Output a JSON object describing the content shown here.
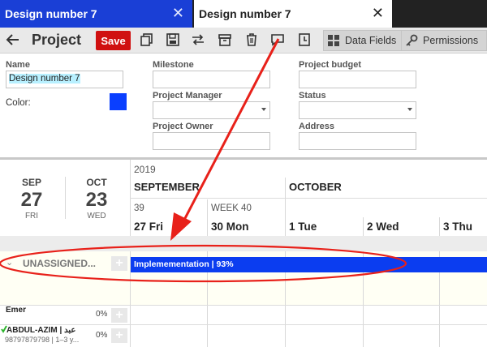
{
  "tabs": [
    {
      "title": "Design number 7",
      "active": false
    },
    {
      "title": "Design number 7",
      "active": true
    }
  ],
  "toolbar": {
    "title": "Project",
    "save_label": "Save",
    "data_fields_label": "Data Fields",
    "permissions_label": "Permissions",
    "icons": [
      "back-arrow-icon",
      "copy-icon",
      "save-all-icon",
      "swap-icon",
      "archive-icon",
      "delete-icon",
      "comment-icon",
      "history-icon"
    ]
  },
  "form": {
    "name_label": "Name",
    "name_value": "Design number 7",
    "color_label": "Color:",
    "color_value": "#0a3fff",
    "milestone_label": "Milestone",
    "milestone_value": "",
    "project_manager_label": "Project Manager",
    "project_manager_value": "",
    "project_owner_label": "Project Owner",
    "project_owner_value": "",
    "budget_label": "Project budget",
    "budget_value": "",
    "status_label": "Status",
    "status_value": "",
    "address_label": "Address",
    "address_value": ""
  },
  "timeline": {
    "start": {
      "month": "SEP",
      "day": "27",
      "weekday": "FRI"
    },
    "end": {
      "month": "OCT",
      "day": "23",
      "weekday": "WED"
    },
    "year": "2019",
    "months": [
      "SEPTEMBER",
      "OCTOBER"
    ],
    "weeks": [
      "39",
      "WEEK 40"
    ],
    "days": [
      "27 Fri",
      "30 Mon",
      "1 Tue",
      "2 Wed",
      "3 Thu"
    ]
  },
  "unassigned": {
    "label": "UNASSIGNED...",
    "bar_label": "Implemementation | 93%",
    "progress": 93
  },
  "resources": [
    {
      "name": "Emer",
      "pct": "0%"
    },
    {
      "name": "ABDUL-AZIM | عبد",
      "sub": "98797879798 | 1–3 y...",
      "pct": "0%"
    }
  ],
  "annotation": {
    "color": "#e8211a"
  }
}
